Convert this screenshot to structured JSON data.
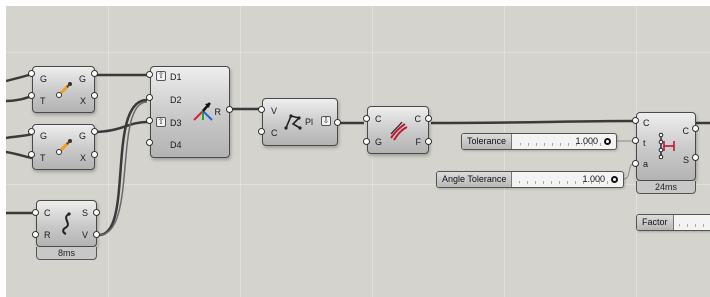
{
  "components": {
    "evaluate_top": {
      "in": [
        "G",
        "T"
      ],
      "out": [
        "G",
        "X"
      ]
    },
    "evaluate_mid": {
      "in": [
        "G",
        "T"
      ],
      "out": [
        "G",
        "X"
      ]
    },
    "sub_curve": {
      "in": [
        "C",
        "R"
      ],
      "out": [
        "S",
        "V"
      ],
      "timer": "8ms"
    },
    "merge": {
      "in": [
        "D1",
        "D2",
        "D3",
        "D4"
      ],
      "out": [
        "R"
      ]
    },
    "polyline": {
      "in": [
        "V",
        "C"
      ],
      "out": [
        "Pl"
      ]
    },
    "fillet": {
      "in": [
        "C",
        "G"
      ],
      "out": [
        "C",
        "F"
      ]
    },
    "simplify": {
      "in": [
        "C",
        "t",
        "a"
      ],
      "out": [
        "C",
        "S"
      ],
      "timer": "24ms"
    }
  },
  "sliders": {
    "tolerance": {
      "name": "Tolerance",
      "value": "1.000"
    },
    "angle_tolerance": {
      "name": "Angle Tolerance",
      "value": "1.000"
    },
    "factor": {
      "name": "Factor"
    }
  },
  "icons": [
    "evaluate-icon",
    "merge-icon",
    "polyline-icon",
    "fillet-icon",
    "simplify-icon",
    "sub-curve-icon"
  ]
}
